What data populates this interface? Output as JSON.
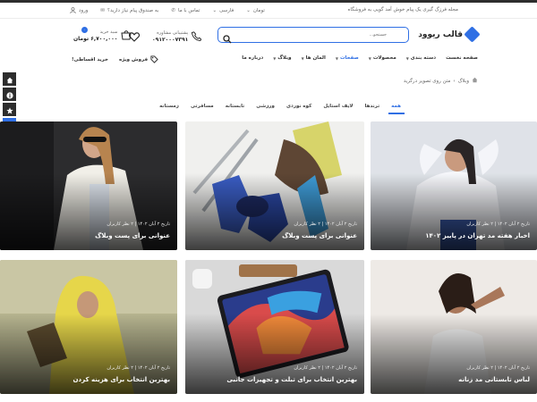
{
  "topbar": {
    "message": "مجله فرزگ گیری یک پیام خوش آمد گویی به فروشگاه",
    "currency": "تومان",
    "language": "فارسی",
    "contact": "تماس با ما",
    "track_order": "به صندوق پیام نیاز دارید؟",
    "login": "ورود"
  },
  "header": {
    "logo": "قالب ریوود",
    "search_placeholder": "جستجو...",
    "support_label": "پشتیبانی مشاوره",
    "support_phone": "۰۹۱۲۰۰۰۷۳۹۱",
    "cart_label": "سبد خرید",
    "cart_total": "۶,۷۰۰,۰۰۰ تومان",
    "cart_count": "۰"
  },
  "nav": {
    "items": [
      {
        "label": "صفحه نخست",
        "caret": false
      },
      {
        "label": "دسته بندی",
        "caret": true
      },
      {
        "label": "محصولات",
        "caret": true
      },
      {
        "label": "صفحات",
        "caret": true
      },
      {
        "label": "المان ها",
        "caret": true
      },
      {
        "label": "وبلاگ",
        "caret": true
      },
      {
        "label": "درباره ما",
        "caret": false
      }
    ],
    "special_sale": "فروش ویژه",
    "installment": "خرید اقساطی!"
  },
  "breadcrumb": {
    "home": "وبلاگ",
    "separator": "›",
    "current": "متن روی تصویر درگرید"
  },
  "tabs": [
    "همه",
    "ترندها",
    "لایف استایل",
    "کوه نوردی",
    "ورزشی",
    "تابستانه",
    "مسافرتی",
    "زمستانه"
  ],
  "cards": [
    {
      "meta": "تاریخ ۲ آبان ۱۴۰۲ | ۲ نظر کاربران",
      "title": "اخبار هفته مد تهران در پاییز ۱۴۰۲"
    },
    {
      "meta": "تاریخ ۲ آبان ۱۴۰۲ | ۲ نظر کاربران",
      "title": "عنوانی برای پست وبلاگ"
    },
    {
      "meta": "تاریخ ۲ آبان ۱۴۰۲ | ۲ نظر کاربران",
      "title": "عنوانی برای پست وبلاگ"
    },
    {
      "meta": "تاریخ ۲ آبان ۱۴۰۲ | ۲ نظر کاربران",
      "title": "لباس تابستانی مد زنانه"
    },
    {
      "meta": "تاریخ ۲ آبان ۱۴۰۲ | ۲ نظر کاربران",
      "title": "بهترین انتخاب برای تبلت و تجهیزات جانبی"
    },
    {
      "meta": "تاریخ ۲ آبان ۱۴۰۲ | ۲ نظر کاربران",
      "title": "بهترین انتخاب برای هزینه کردن"
    }
  ],
  "colors": {
    "accent": "#2f6fe4",
    "dark": "#2d2d2d"
  }
}
